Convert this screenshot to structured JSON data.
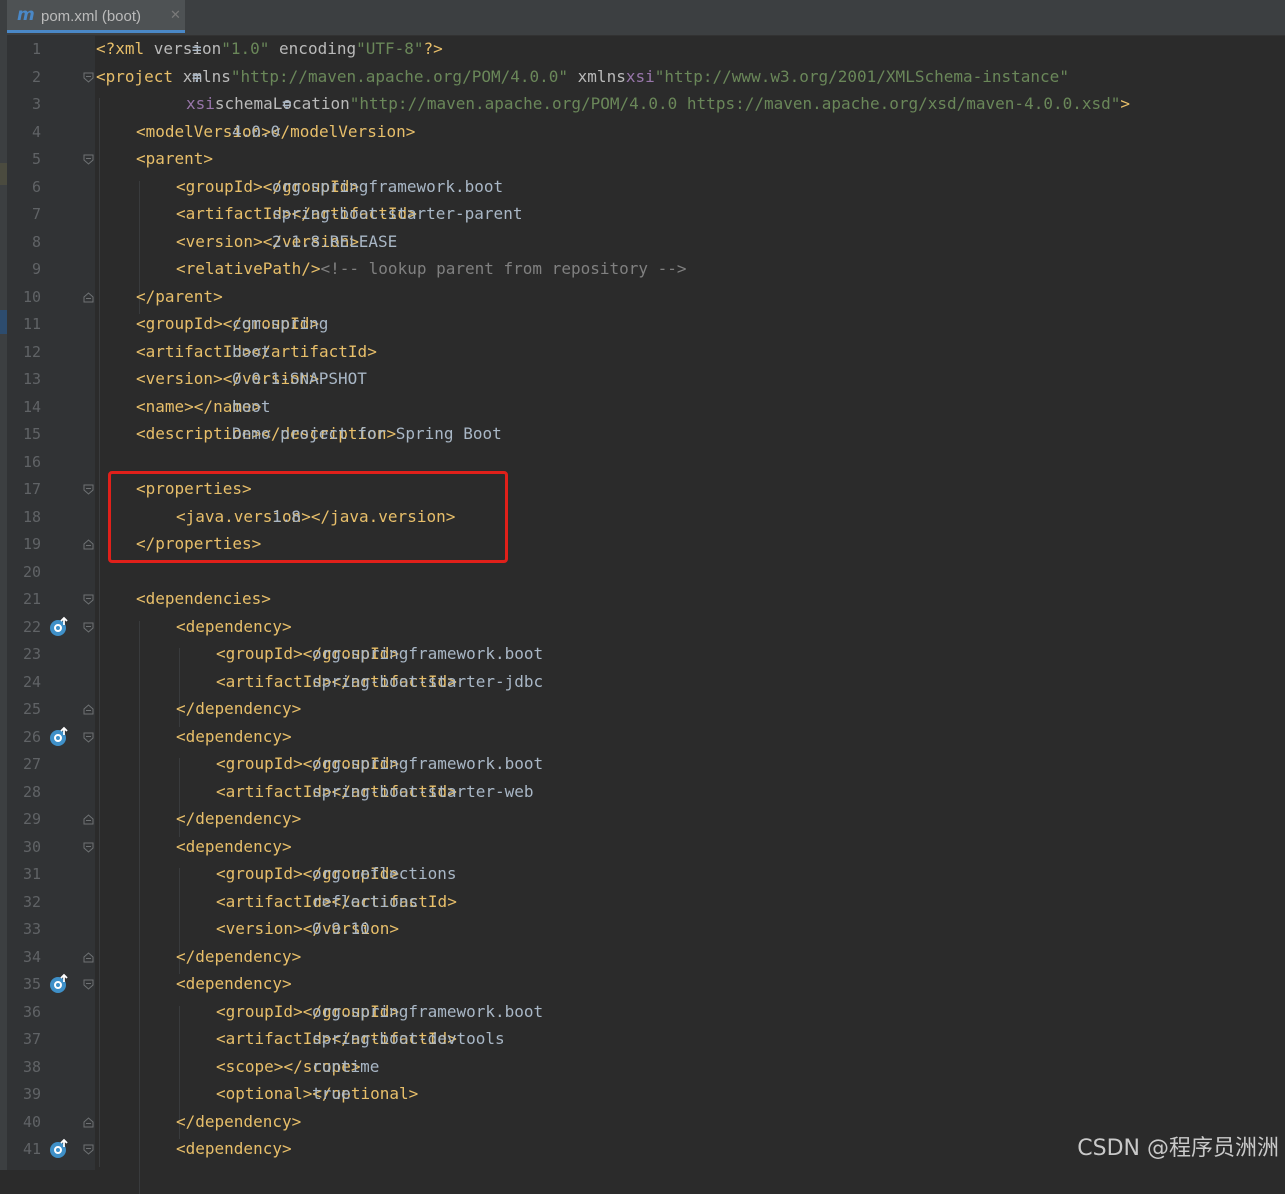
{
  "tab": {
    "icon": "maven-m-icon",
    "icon_glyph": "m",
    "label": "pom.xml (boot)",
    "close_glyph": "✕"
  },
  "lines": [
    {
      "n": "1",
      "indent": 0,
      "tokens": [
        [
          "tag",
          "<?xml "
        ],
        [
          "attr",
          "version"
        ],
        [
          "code",
          "="
        ],
        [
          "str",
          "\"1.0\""
        ],
        [
          "attr",
          " encoding"
        ],
        [
          "code",
          "="
        ],
        [
          "str",
          "\"UTF-8\""
        ],
        [
          "tag",
          "?>"
        ]
      ]
    },
    {
      "n": "2",
      "indent": 0,
      "fold": "open",
      "tokens": [
        [
          "tag",
          "<project "
        ],
        [
          "attr",
          "xmlns"
        ],
        [
          "code",
          "="
        ],
        [
          "str",
          "\"http://maven.apache.org/POM/4.0.0\""
        ],
        [
          "attr",
          " xmlns"
        ],
        [
          "code",
          ":"
        ],
        [
          "ns",
          "xsi"
        ],
        [
          "code",
          "="
        ],
        [
          "str",
          "\"http://www.w3.org/2001/XMLSchema-instance\""
        ]
      ]
    },
    {
      "n": "3",
      "indent": 9,
      "tokens": [
        [
          "ns",
          "xsi"
        ],
        [
          "code",
          ":"
        ],
        [
          "attr",
          "schemaLocation"
        ],
        [
          "code",
          "="
        ],
        [
          "str",
          "\"http://maven.apache.org/POM/4.0.0 https://maven.apache.org/xsd/maven-4.0.0.xsd\""
        ],
        [
          "tag",
          ">"
        ]
      ]
    },
    {
      "n": "4",
      "indent": 4,
      "tokens": [
        [
          "tag",
          "<modelVersion>"
        ],
        [
          "code",
          "4.0.0"
        ],
        [
          "tag",
          "</modelVersion>"
        ]
      ]
    },
    {
      "n": "5",
      "indent": 4,
      "fold": "open",
      "tokens": [
        [
          "tag",
          "<parent>"
        ]
      ]
    },
    {
      "n": "6",
      "indent": 8,
      "tokens": [
        [
          "tag",
          "<groupId>"
        ],
        [
          "code",
          "org.springframework.boot"
        ],
        [
          "tag",
          "</groupId>"
        ]
      ]
    },
    {
      "n": "7",
      "indent": 8,
      "tokens": [
        [
          "tag",
          "<artifactId>"
        ],
        [
          "code",
          "spring-boot-starter-parent"
        ],
        [
          "tag",
          "</artifactId>"
        ]
      ]
    },
    {
      "n": "8",
      "indent": 8,
      "tokens": [
        [
          "tag",
          "<version>"
        ],
        [
          "code",
          "2.1.8.RELEASE"
        ],
        [
          "tag",
          "</version>"
        ]
      ]
    },
    {
      "n": "9",
      "indent": 8,
      "tokens": [
        [
          "tag",
          "<relativePath/>"
        ],
        [
          "code",
          " "
        ],
        [
          "cmt",
          "<!-- lookup parent from repository -->"
        ]
      ]
    },
    {
      "n": "10",
      "indent": 4,
      "fold": "close",
      "tokens": [
        [
          "tag",
          "</parent>"
        ]
      ]
    },
    {
      "n": "11",
      "indent": 4,
      "tokens": [
        [
          "tag",
          "<groupId>"
        ],
        [
          "code",
          "com.spring"
        ],
        [
          "tag",
          "</groupId>"
        ]
      ]
    },
    {
      "n": "12",
      "indent": 4,
      "tokens": [
        [
          "tag",
          "<artifactId>"
        ],
        [
          "code",
          "boot"
        ],
        [
          "tag",
          "</artifactId>"
        ]
      ]
    },
    {
      "n": "13",
      "indent": 4,
      "tokens": [
        [
          "tag",
          "<version>"
        ],
        [
          "code",
          "0.0.1-SNAPSHOT"
        ],
        [
          "tag",
          "</version>"
        ]
      ]
    },
    {
      "n": "14",
      "indent": 4,
      "tokens": [
        [
          "tag",
          "<name>"
        ],
        [
          "code",
          "boot"
        ],
        [
          "tag",
          "</name>"
        ]
      ]
    },
    {
      "n": "15",
      "indent": 4,
      "tokens": [
        [
          "tag",
          "<description>"
        ],
        [
          "code",
          "Demo project for Spring Boot"
        ],
        [
          "tag",
          "</description>"
        ]
      ]
    },
    {
      "n": "16",
      "indent": 0,
      "tokens": []
    },
    {
      "n": "17",
      "indent": 4,
      "fold": "open",
      "tokens": [
        [
          "tag",
          "<properties>"
        ]
      ]
    },
    {
      "n": "18",
      "indent": 8,
      "tokens": [
        [
          "tag",
          "<java.version>"
        ],
        [
          "code",
          "1.8"
        ],
        [
          "tag",
          "</java.version>"
        ]
      ]
    },
    {
      "n": "19",
      "indent": 4,
      "fold": "close",
      "tokens": [
        [
          "tag",
          "</properties>"
        ]
      ]
    },
    {
      "n": "20",
      "indent": 0,
      "tokens": []
    },
    {
      "n": "21",
      "indent": 4,
      "fold": "open",
      "tokens": [
        [
          "tag",
          "<dependencies>"
        ]
      ]
    },
    {
      "n": "22",
      "indent": 8,
      "fold": "open",
      "gutter_icon": "maven-dependency-icon",
      "tokens": [
        [
          "tag",
          "<dependency>"
        ]
      ]
    },
    {
      "n": "23",
      "indent": 12,
      "tokens": [
        [
          "tag",
          "<groupId>"
        ],
        [
          "code",
          "org.springframework.boot"
        ],
        [
          "tag",
          "</groupId>"
        ]
      ]
    },
    {
      "n": "24",
      "indent": 12,
      "tokens": [
        [
          "tag",
          "<artifactId>"
        ],
        [
          "code",
          "spring-boot-starter-jdbc"
        ],
        [
          "tag",
          "</artifactId>"
        ]
      ]
    },
    {
      "n": "25",
      "indent": 8,
      "fold": "close",
      "tokens": [
        [
          "tag",
          "</dependency>"
        ]
      ]
    },
    {
      "n": "26",
      "indent": 8,
      "fold": "open",
      "gutter_icon": "maven-dependency-icon",
      "tokens": [
        [
          "tag",
          "<dependency>"
        ]
      ]
    },
    {
      "n": "27",
      "indent": 12,
      "tokens": [
        [
          "tag",
          "<groupId>"
        ],
        [
          "code",
          "org.springframework.boot"
        ],
        [
          "tag",
          "</groupId>"
        ]
      ]
    },
    {
      "n": "28",
      "indent": 12,
      "tokens": [
        [
          "tag",
          "<artifactId>"
        ],
        [
          "code",
          "spring-boot-starter-web"
        ],
        [
          "tag",
          "</artifactId>"
        ]
      ]
    },
    {
      "n": "29",
      "indent": 8,
      "fold": "close",
      "tokens": [
        [
          "tag",
          "</dependency>"
        ]
      ]
    },
    {
      "n": "30",
      "indent": 8,
      "fold": "open",
      "tokens": [
        [
          "tag",
          "<dependency>"
        ]
      ]
    },
    {
      "n": "31",
      "indent": 12,
      "tokens": [
        [
          "tag",
          "<groupId>"
        ],
        [
          "code",
          "org.reflections"
        ],
        [
          "tag",
          "</groupId>"
        ]
      ]
    },
    {
      "n": "32",
      "indent": 12,
      "tokens": [
        [
          "tag",
          "<artifactId>"
        ],
        [
          "code",
          "reflections"
        ],
        [
          "tag",
          "</artifactId>"
        ]
      ]
    },
    {
      "n": "33",
      "indent": 12,
      "tokens": [
        [
          "tag",
          "<version>"
        ],
        [
          "code",
          "0.9.10"
        ],
        [
          "tag",
          "</version>"
        ]
      ]
    },
    {
      "n": "34",
      "indent": 8,
      "fold": "close",
      "tokens": [
        [
          "tag",
          "</dependency>"
        ]
      ]
    },
    {
      "n": "35",
      "indent": 8,
      "fold": "open",
      "gutter_icon": "maven-dependency-icon",
      "tokens": [
        [
          "tag",
          "<dependency>"
        ]
      ]
    },
    {
      "n": "36",
      "indent": 12,
      "tokens": [
        [
          "tag",
          "<groupId>"
        ],
        [
          "code",
          "org.springframework.boot"
        ],
        [
          "tag",
          "</groupId>"
        ]
      ]
    },
    {
      "n": "37",
      "indent": 12,
      "tokens": [
        [
          "tag",
          "<artifactId>"
        ],
        [
          "code",
          "spring-boot-devtools"
        ],
        [
          "tag",
          "</artifactId>"
        ]
      ]
    },
    {
      "n": "38",
      "indent": 12,
      "tokens": [
        [
          "tag",
          "<scope>"
        ],
        [
          "code",
          "runtime"
        ],
        [
          "tag",
          "</scope>"
        ]
      ]
    },
    {
      "n": "39",
      "indent": 12,
      "tokens": [
        [
          "tag",
          "<optional>"
        ],
        [
          "code",
          "true"
        ],
        [
          "tag",
          "</optional>"
        ]
      ]
    },
    {
      "n": "40",
      "indent": 8,
      "fold": "close",
      "tokens": [
        [
          "tag",
          "</dependency>"
        ]
      ]
    },
    {
      "n": "41",
      "indent": 8,
      "fold": "open",
      "gutter_icon": "maven-dependency-icon",
      "tokens": [
        [
          "tag",
          "<dependency>"
        ]
      ]
    }
  ],
  "highlight": {
    "color": "#e0201a"
  },
  "watermark": "CSDN @程序员洲洲",
  "colors": {
    "background": "#2b2b2b",
    "gutter": "#313335",
    "tag": "#e8bf6a",
    "string": "#6a8759",
    "comment": "#808080",
    "text": "#a9b7c6",
    "namespace": "#9876aa",
    "line_number": "#606366"
  }
}
